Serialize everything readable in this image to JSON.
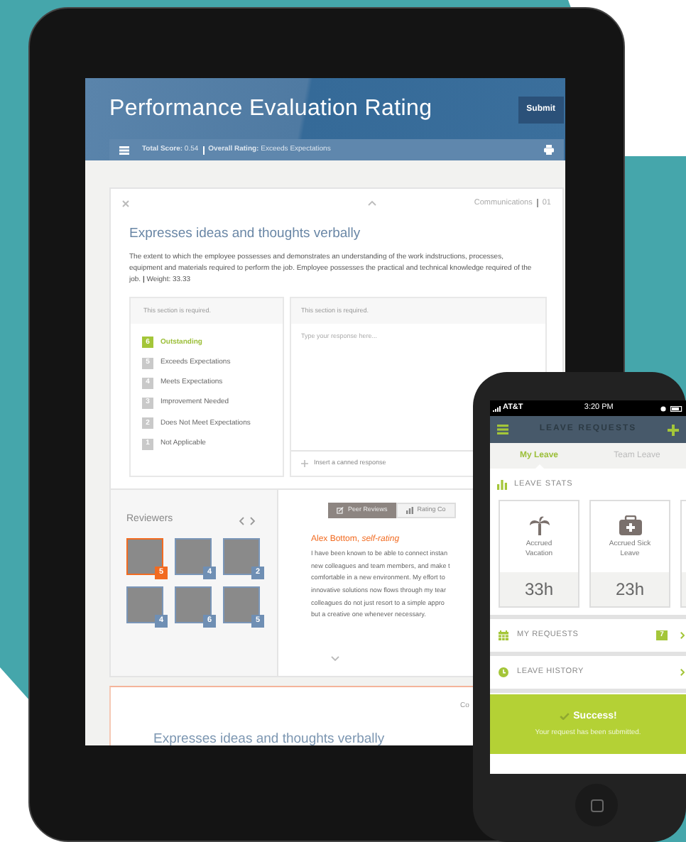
{
  "tablet": {
    "header": {
      "title": "Performance Evaluation Rating",
      "submit_button": "Submit"
    },
    "toolbar": {
      "total_score_label": "Total Score:",
      "total_score": "0.54",
      "overall_rating_label": "Overall Rating:",
      "overall_rating": "Exceeds Expectations"
    },
    "card": {
      "category": "Communications",
      "number": "01",
      "title": "Expresses ideas and thoughts verbally",
      "description": "The extent to which the employee possesses and demonstrates an understanding of the work indstructions, processes, equipment and materials required to perform the job. Employee possesses the practical and technical knowledge required of the job. **|** Weight: 33.33",
      "rating_panel": {
        "header": "This section is required.",
        "options": [
          {
            "number": "6",
            "label": "Outstanding",
            "selected": true
          },
          {
            "number": "5",
            "label": "Exceeds Expectations",
            "selected": false
          },
          {
            "number": "4",
            "label": "Meets Expectations",
            "selected": false
          },
          {
            "number": "3",
            "label": "Improvement Needed",
            "selected": false
          },
          {
            "number": "2",
            "label": "Does Not Meet Expectations",
            "selected": false
          },
          {
            "number": "1",
            "label": "Not Applicable",
            "selected": false
          }
        ]
      },
      "response_panel": {
        "header": "This section is required.",
        "placeholder": "Type your response here...",
        "canned_response": "Insert a canned response"
      }
    },
    "reviewers": {
      "title": "Reviewers",
      "people": [
        {
          "score": "5",
          "selected": true
        },
        {
          "score": "4",
          "selected": false
        },
        {
          "score": "2",
          "selected": false
        },
        {
          "score": "4",
          "selected": false
        },
        {
          "score": "6",
          "selected": false
        },
        {
          "score": "5",
          "selected": false
        }
      ]
    },
    "review": {
      "tabs": [
        {
          "label": "Peer Reviews",
          "selected": true
        },
        {
          "label": "Rating Co",
          "selected": false
        }
      ],
      "author": "Alex Bottom, *self-rating*",
      "lines": [
        "I have been known to be able to connect instan",
        "new colleagues and team members, and make t",
        "comfortable in a new environment. My effort to",
        "innovative solutions now flows through my tear",
        "colleagues do not just resort to a simple appro",
        "but a creative one whenever necessary."
      ]
    },
    "next_card": {
      "category": "Co",
      "title": "Expresses ideas and thoughts verbally"
    }
  },
  "phone": {
    "status_bar": {
      "carrier": "AT&T",
      "time": "3:20 PM"
    },
    "header": {
      "title": "LEAVE REQUESTS"
    },
    "tabs": [
      {
        "label": "My Leave",
        "selected": true
      },
      {
        "label": "Team Leave",
        "selected": false
      }
    ],
    "stats": {
      "title": "LEAVE STATS",
      "cards": [
        {
          "kind": "vacation",
          "label": "Accrued Vacation",
          "value": "33h"
        },
        {
          "kind": "sick",
          "label": "Accrued Sick Leave",
          "value": "23h"
        },
        {
          "kind": "blank"
        }
      ]
    },
    "rows": [
      {
        "kind": "calendar",
        "label": "MY REQUESTS",
        "badge": "7"
      },
      {
        "kind": "clock",
        "label": "LEAVE HISTORY"
      }
    ],
    "banner": {
      "title": "Success!",
      "message": "Your request has been submitted."
    }
  }
}
